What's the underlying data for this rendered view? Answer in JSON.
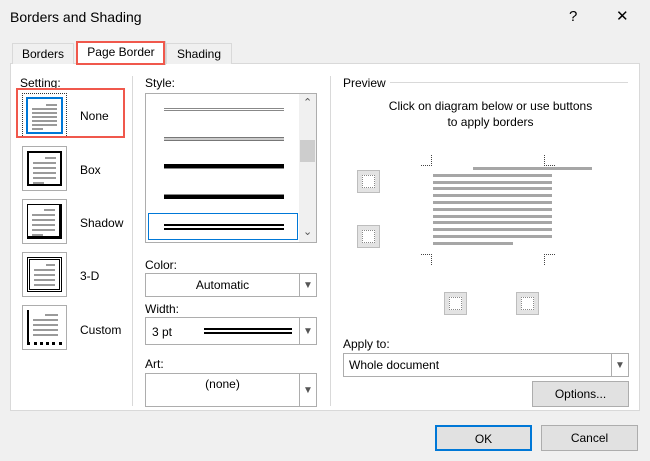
{
  "window": {
    "title": "Borders and Shading",
    "help": "?",
    "close": "✕"
  },
  "tabs": [
    {
      "label": "Borders"
    },
    {
      "label": "Page Border"
    },
    {
      "label": "Shading"
    }
  ],
  "setting": {
    "label": "Setting:",
    "options": [
      {
        "label": "None"
      },
      {
        "label": "Box"
      },
      {
        "label": "Shadow"
      },
      {
        "label": "3-D"
      },
      {
        "label": "Custom"
      }
    ]
  },
  "style": {
    "label": "Style:"
  },
  "color": {
    "label": "Color:",
    "value": "Automatic"
  },
  "width": {
    "label": "Width:",
    "value": "3 pt"
  },
  "art": {
    "label": "Art:",
    "value": "(none)"
  },
  "preview": {
    "label": "Preview",
    "hint1": "Click on diagram below or use buttons",
    "hint2": "to apply borders"
  },
  "apply_to": {
    "label": "Apply to:",
    "value": "Whole document"
  },
  "buttons": {
    "options": "Options...",
    "ok": "OK",
    "cancel": "Cancel"
  },
  "colors": {
    "highlight": "#f0584c",
    "selection": "#0078d7"
  }
}
